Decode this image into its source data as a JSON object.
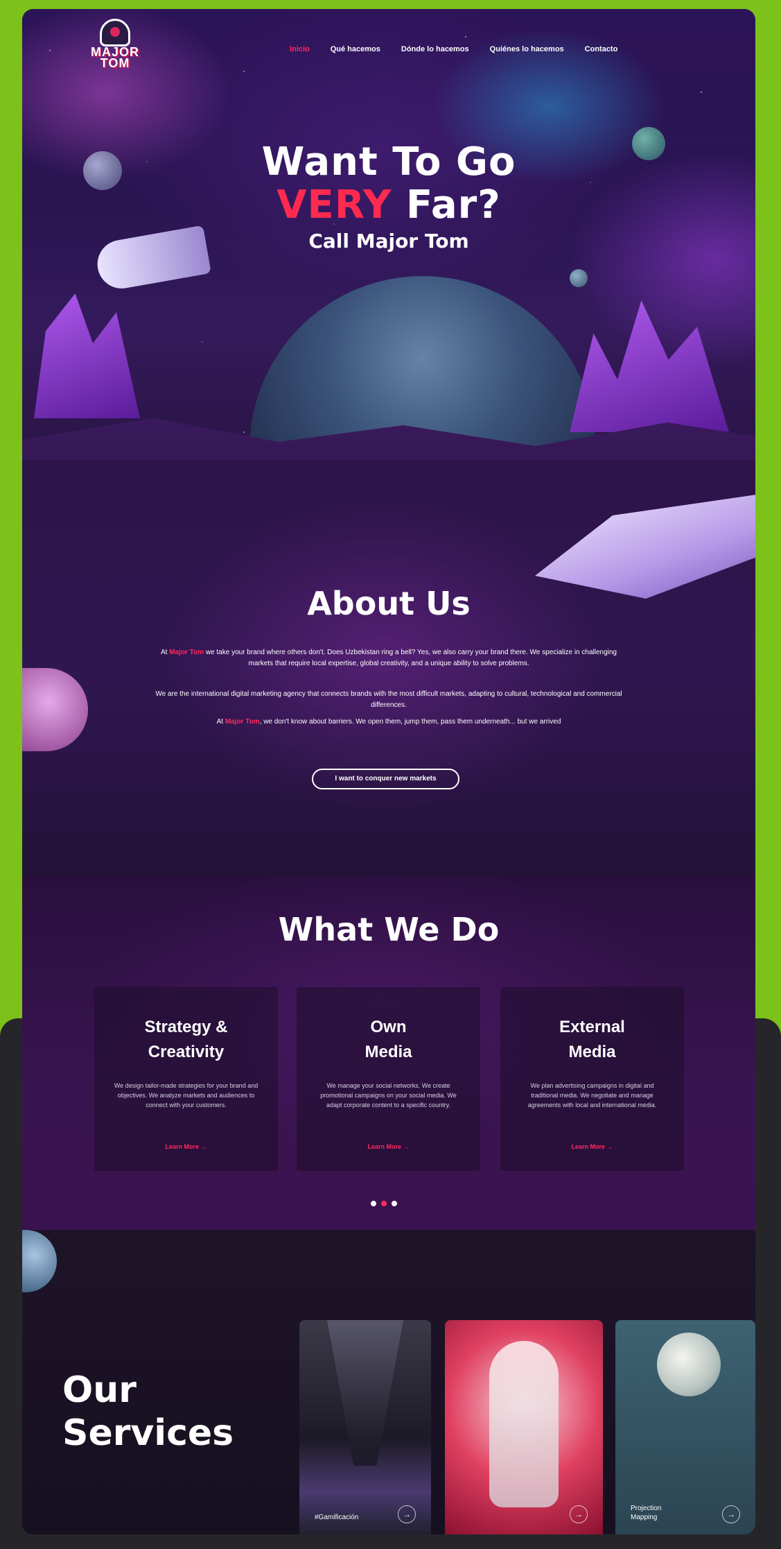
{
  "nav": {
    "logo_text": "MAJOR TOM",
    "items": [
      {
        "label": "Inicio",
        "active": true
      },
      {
        "label": "Qué hacemos",
        "active": false
      },
      {
        "label": "Dónde lo hacemos",
        "active": false
      },
      {
        "label": "Quiénes lo hacemos",
        "active": false
      },
      {
        "label": "Contacto",
        "active": false
      }
    ]
  },
  "hero": {
    "line1": "Want To Go",
    "accent": "VERY",
    "line2_rest": " Far?",
    "subtitle": "Call Major Tom"
  },
  "about": {
    "title": "About Us",
    "p1_prefix": "At ",
    "brand": "Major Tom",
    "p1_rest": " we take your brand where others don't. Does Uzbekistan ring a bell? Yes, we also carry your brand there. We specialize in challenging markets that require local expertise, global creativity, and a unique ability to solve problems.",
    "p2": "We are the international digital marketing agency that connects brands with the most difficult markets, adapting to cultural, technological and commercial differences.",
    "p3_prefix": "At ",
    "p3_rest": ", we don't know about barriers. We open them, jump them, pass them underneath... but we arrived",
    "cta": "I want to conquer new markets"
  },
  "what_we_do": {
    "title": "What We Do",
    "cards": [
      {
        "title_l1": "Strategy &",
        "title_l2": "Creativity",
        "desc": "We design tailor-made strategies for your brand and objectives. We analyze markets and audiences to connect with your customers.",
        "link": "Learn More →"
      },
      {
        "title_l1": "Own",
        "title_l2": "Media",
        "desc": "We manage your social networks. We create promotional campaigns on your social media. We adapt corporate content to a specific country.",
        "link": "Learn More →"
      },
      {
        "title_l1": "External",
        "title_l2": "Media",
        "desc": "We plan advertising campaigns in digital and traditional media. We negotiate and manage agreements with local and international media.",
        "link": "Learn More →"
      }
    ],
    "pagination": {
      "total": 3,
      "active_index": 1
    }
  },
  "services": {
    "title_l1": "Our",
    "title_l2": "Services",
    "cards": [
      {
        "label": "#Gamificación",
        "arrow": "→"
      },
      {
        "label": "",
        "arrow": "→"
      },
      {
        "label_l1": "Projection",
        "label_l2": "Mapping",
        "arrow": "→"
      }
    ]
  },
  "colors": {
    "accent": "#ff2a5f",
    "page_background": "#7cc21a",
    "site_background": "#2c1448"
  }
}
